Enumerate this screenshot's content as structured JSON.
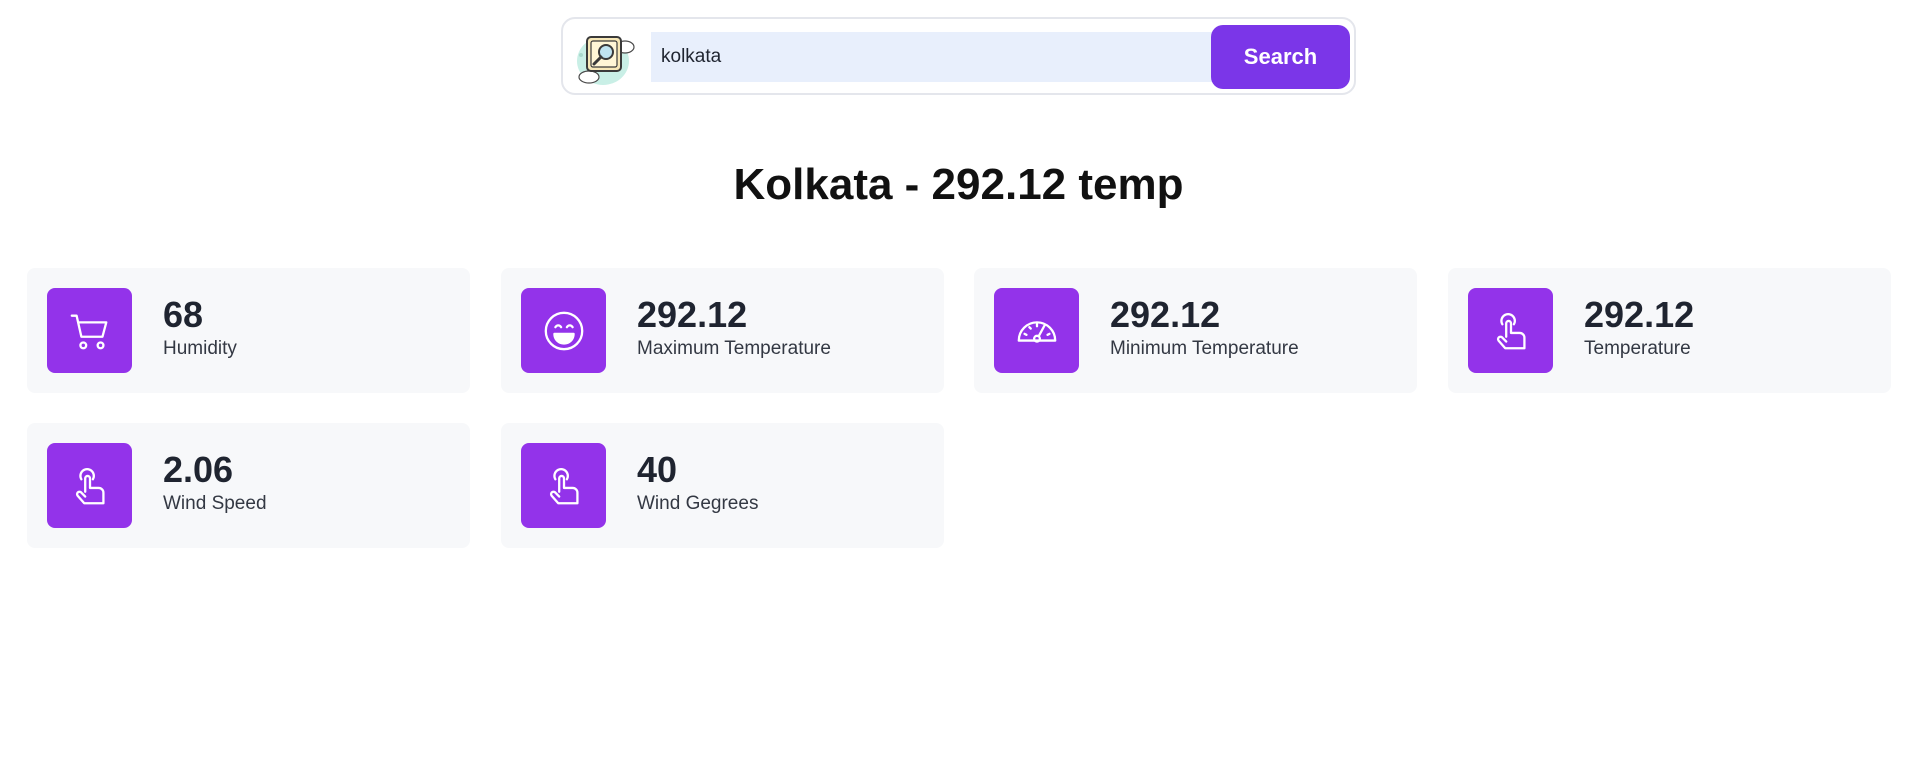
{
  "search": {
    "value": "kolkata",
    "button_label": "Search",
    "logo_icon": "weather-search-logo-icon"
  },
  "title": "Kolkata - 292.12 temp",
  "colors": {
    "accent": "#7b36e8",
    "icon_bg": "#9333ea",
    "card_bg": "#f7f8fa",
    "input_bg": "#e8effc"
  },
  "cards": [
    {
      "value": "68",
      "label": "Humidity",
      "icon": "cart-icon"
    },
    {
      "value": "292.12",
      "label": "Maximum Temperature",
      "icon": "smile-icon"
    },
    {
      "value": "292.12",
      "label": "Minimum Temperature",
      "icon": "gauge-icon"
    },
    {
      "value": "292.12",
      "label": "Temperature",
      "icon": "pointer-hand-icon"
    },
    {
      "value": "2.06",
      "label": "Wind Speed",
      "icon": "pointer-hand-icon"
    },
    {
      "value": "40",
      "label": "Wind Gegrees",
      "icon": "pointer-hand-icon"
    }
  ]
}
